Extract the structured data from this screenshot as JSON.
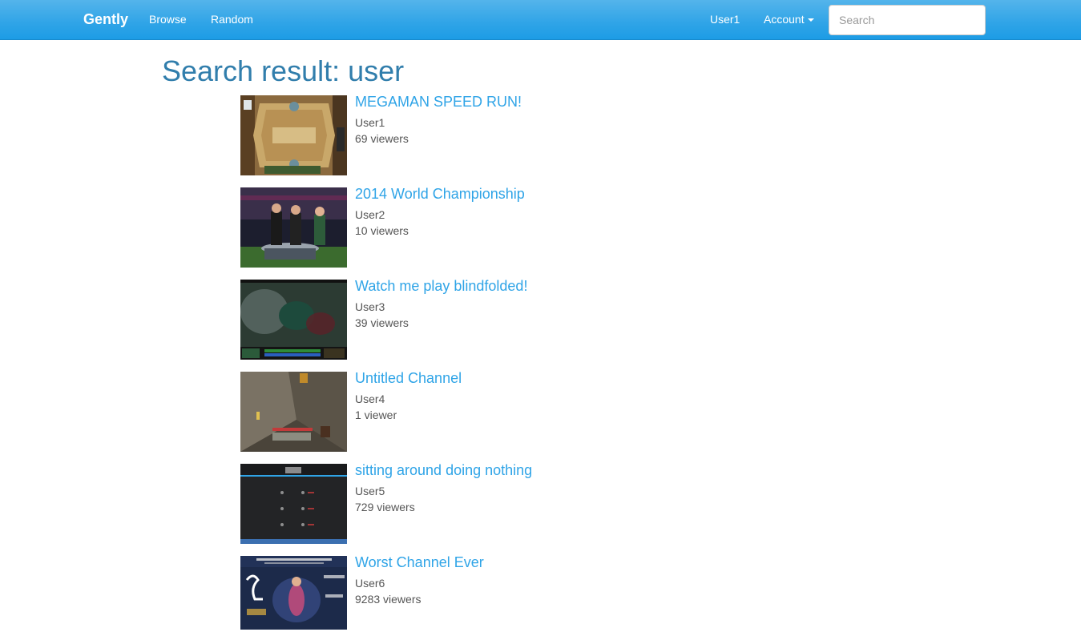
{
  "navbar": {
    "brand": "Gently",
    "links": [
      "Browse",
      "Random"
    ],
    "user": "User1",
    "account": "Account",
    "search_placeholder": "Search"
  },
  "page": {
    "title": "Search result: user"
  },
  "results": [
    {
      "title": "MEGAMAN SPEED RUN!",
      "user": "User1",
      "viewers": "69 viewers",
      "thumbnail": "card-game-board"
    },
    {
      "title": "2014 World Championship",
      "user": "User2",
      "viewers": "10 viewers",
      "thumbnail": "esports-desk"
    },
    {
      "title": "Watch me play blindfolded!",
      "user": "User3",
      "viewers": "39 viewers",
      "thumbnail": "moba-gameplay"
    },
    {
      "title": "Untitled Channel",
      "user": "User4",
      "viewers": "1 viewer",
      "thumbnail": "block-cave"
    },
    {
      "title": "sitting around doing nothing",
      "user": "User5",
      "viewers": "729 viewers",
      "thumbnail": "tournament-bracket"
    },
    {
      "title": "Worst Channel Ever",
      "user": "User6",
      "viewers": "9283 viewers",
      "thumbnail": "hero-treasure-promo"
    }
  ]
}
